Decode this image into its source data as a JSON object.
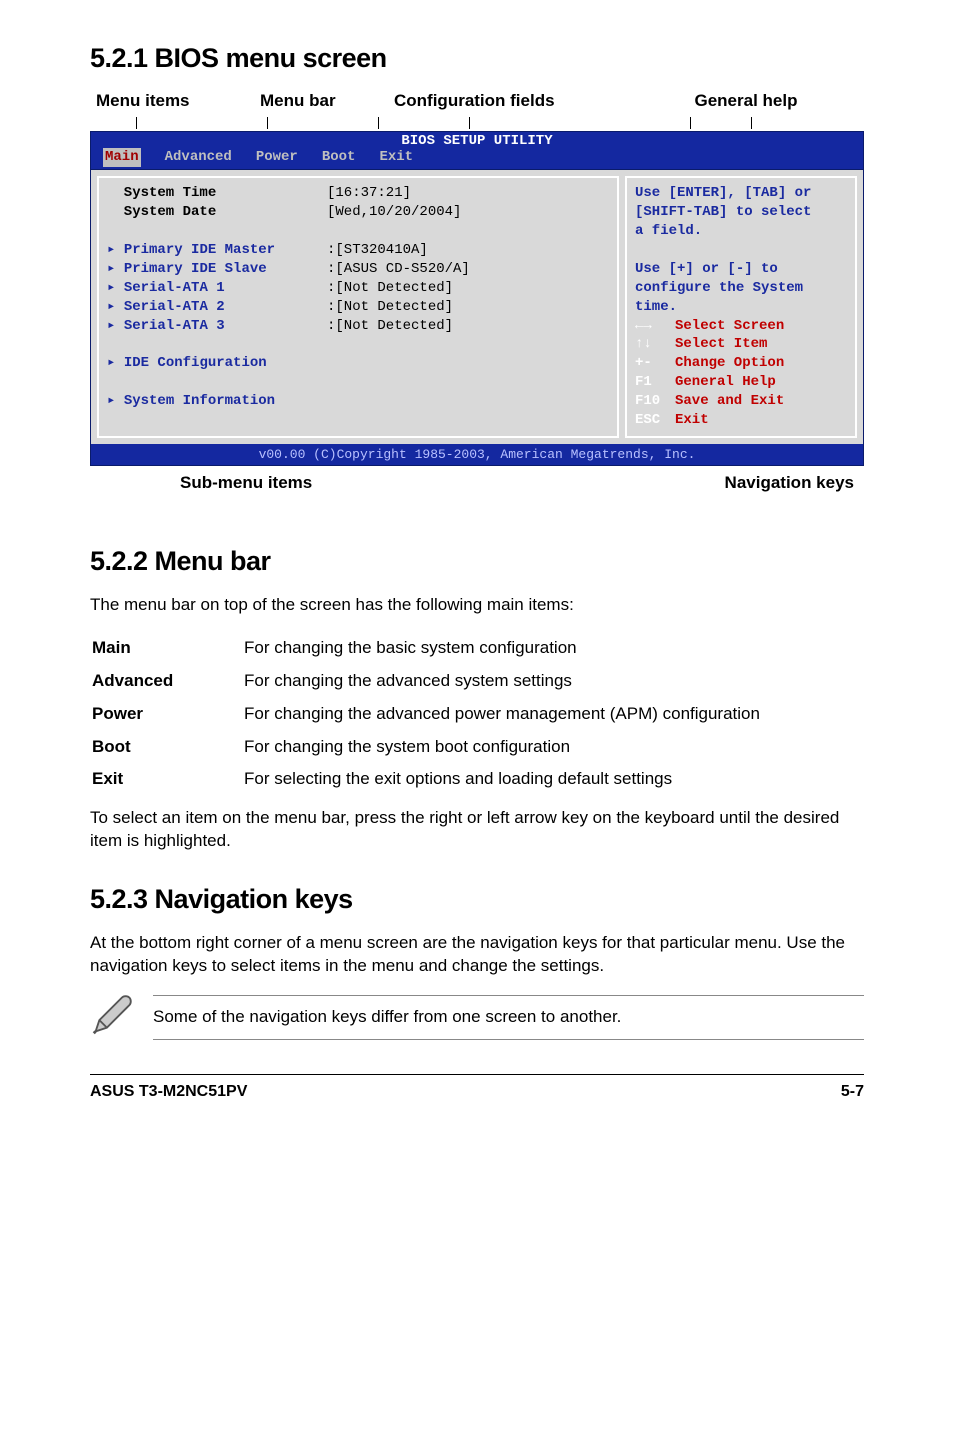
{
  "section_521": {
    "title": "5.2.1   BIOS menu screen",
    "callouts_top": [
      "Menu items",
      "Menu bar",
      "Configuration fields",
      "General help"
    ],
    "callouts_bottom": [
      "Sub-menu items",
      "Navigation keys"
    ]
  },
  "bios": {
    "title": "BIOS SETUP UTILITY",
    "tabs": [
      "Main",
      "Advanced",
      "Power",
      "Boot",
      "Exit"
    ],
    "active_tab": "Main",
    "left_rows": [
      {
        "label": "System Time",
        "value": "[16:37:21]",
        "submenu": false,
        "black": true
      },
      {
        "label": "System Date",
        "value": "[Wed,10/20/2004]",
        "submenu": false,
        "black": true
      },
      {
        "label": "",
        "value": "",
        "submenu": false,
        "spacer": true
      },
      {
        "label": "Primary IDE Master",
        "value": ":[ST320410A]",
        "submenu": true
      },
      {
        "label": "Primary IDE Slave",
        "value": ":[ASUS CD-S520/A]",
        "submenu": true
      },
      {
        "label": "Serial-ATA 1",
        "value": ":[Not Detected]",
        "submenu": true
      },
      {
        "label": "Serial-ATA 2",
        "value": ":[Not Detected]",
        "submenu": true
      },
      {
        "label": "Serial-ATA 3",
        "value": ":[Not Detected]",
        "submenu": true
      },
      {
        "label": "",
        "value": "",
        "submenu": false,
        "spacer": true
      },
      {
        "label": "IDE Configuration",
        "value": "",
        "submenu": true
      },
      {
        "label": "",
        "value": "",
        "submenu": false,
        "spacer": true
      },
      {
        "label": "System Information",
        "value": "",
        "submenu": true
      }
    ],
    "help_top": "Use [ENTER], [TAB] or\n[SHIFT-TAB] to select\na field.\n\nUse [+] or [-] to\nconfigure the System\ntime.",
    "nav": [
      {
        "key": "←→",
        "desc": "Select Screen",
        "red": true
      },
      {
        "key": "↑↓",
        "desc": "Select Item",
        "red": true
      },
      {
        "key": "+-",
        "desc": "Change Option",
        "red": true
      },
      {
        "key": "F1",
        "desc": "General Help",
        "red": true
      },
      {
        "key": "F10",
        "desc": "Save and Exit",
        "red": true
      },
      {
        "key": "ESC",
        "desc": "Exit",
        "red": true
      }
    ],
    "footer": "v00.00 (C)Copyright 1985-2003, American Megatrends, Inc."
  },
  "section_522": {
    "title": "5.2.2   Menu bar",
    "intro": "The menu bar on top of the screen has the following main items:",
    "defs": [
      {
        "term": "Main",
        "desc": "For changing the basic system configuration"
      },
      {
        "term": "Advanced",
        "desc": "For changing the advanced system settings"
      },
      {
        "term": "Power",
        "desc": "For changing the advanced power management (APM) configuration"
      },
      {
        "term": "Boot",
        "desc": "For changing the system boot configuration"
      },
      {
        "term": "Exit",
        "desc": "For selecting the exit options and loading default settings"
      }
    ],
    "outro": "To select an item on the menu bar, press the right or left arrow key on the keyboard until the desired item is highlighted."
  },
  "section_523": {
    "title": "5.2.3   Navigation keys",
    "body": "At the bottom right corner of a menu screen are the navigation keys for that particular menu. Use the navigation keys to select items in the menu and change the settings.",
    "note": "Some of the navigation keys differ from one screen to another."
  },
  "footer": {
    "left": "ASUS T3-M2NC51PV",
    "right": "5-7"
  }
}
